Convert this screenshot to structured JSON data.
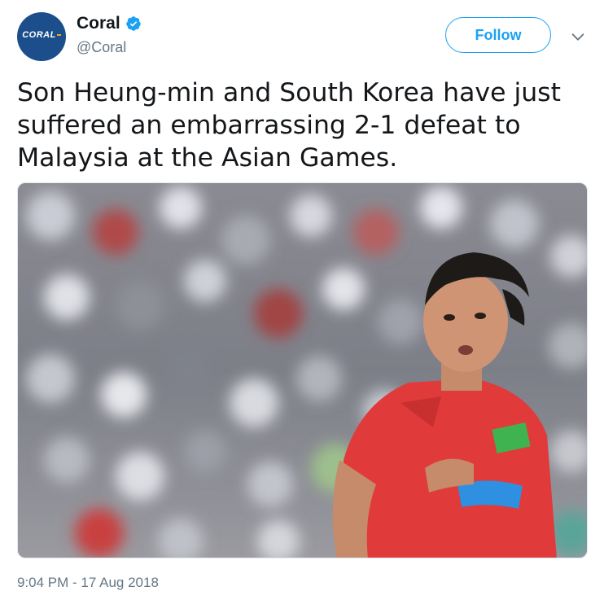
{
  "account": {
    "display_name": "Coral",
    "handle": "@Coral",
    "avatar_text": "CORAL",
    "verified": true
  },
  "follow_button": {
    "label": "Follow"
  },
  "tweet": {
    "text_lines": [
      "Son Heung-min and South Korea have just",
      "suffered an embarrassing 2-1 defeat to",
      "Malaysia at the Asian Games."
    ],
    "timestamp": "9:04 PM - 17 Aug 2018"
  },
  "icons": {
    "verified": "verified-badge-icon",
    "more": "chevron-down-icon"
  },
  "colors": {
    "brand_blue": "#1da1f2",
    "avatar_bg": "#1c4e8c",
    "text_primary": "#14171a",
    "text_secondary": "#657786"
  }
}
